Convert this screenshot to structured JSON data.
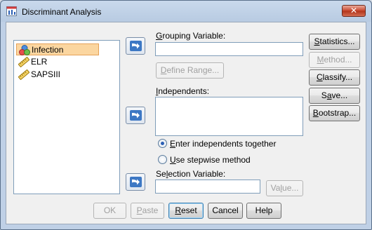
{
  "window": {
    "title": "Discriminant Analysis",
    "close_icon": "close-icon"
  },
  "variables": [
    {
      "name": "Infection",
      "icon": "nominal-icon",
      "selected": true
    },
    {
      "name": "ELR",
      "icon": "scale-icon",
      "selected": false
    },
    {
      "name": "SAPSIII",
      "icon": "scale-icon",
      "selected": false
    }
  ],
  "grouping": {
    "label_u": "G",
    "label_rest": "rouping Variable:",
    "value": "",
    "define_range_pre": "",
    "define_range_u": "D",
    "define_range_rest": "efine Range..."
  },
  "independents": {
    "label_u": "I",
    "label_rest": "ndependents:",
    "value": ""
  },
  "method_options": [
    {
      "pre": "",
      "u": "E",
      "rest": "nter independents together",
      "checked": true
    },
    {
      "pre": "",
      "u": "U",
      "rest": "se stepwise method",
      "checked": false
    }
  ],
  "selection": {
    "label_pre": "Se",
    "label_u": "l",
    "label_rest": "ection Variable:",
    "value": "",
    "value_btn_pre": "Va",
    "value_btn_u": "l",
    "value_btn_rest": "ue..."
  },
  "side_buttons": {
    "statistics": {
      "u": "S",
      "rest": "tatistics..."
    },
    "method": {
      "u": "M",
      "rest": "ethod..."
    },
    "classify": {
      "u": "C",
      "rest": "lassify..."
    },
    "save": {
      "pre": "S",
      "u": "a",
      "rest": "ve..."
    },
    "bootstrap": {
      "u": "B",
      "rest": "ootstrap..."
    }
  },
  "bottom_buttons": {
    "ok": "OK",
    "paste": {
      "u": "P",
      "rest": "aste"
    },
    "reset": {
      "u": "R",
      "rest": "eset"
    },
    "cancel": "Cancel",
    "help": "Help"
  },
  "colors": {
    "selected_bg": "#fbd6a0",
    "accent": "#2b5fb4"
  }
}
